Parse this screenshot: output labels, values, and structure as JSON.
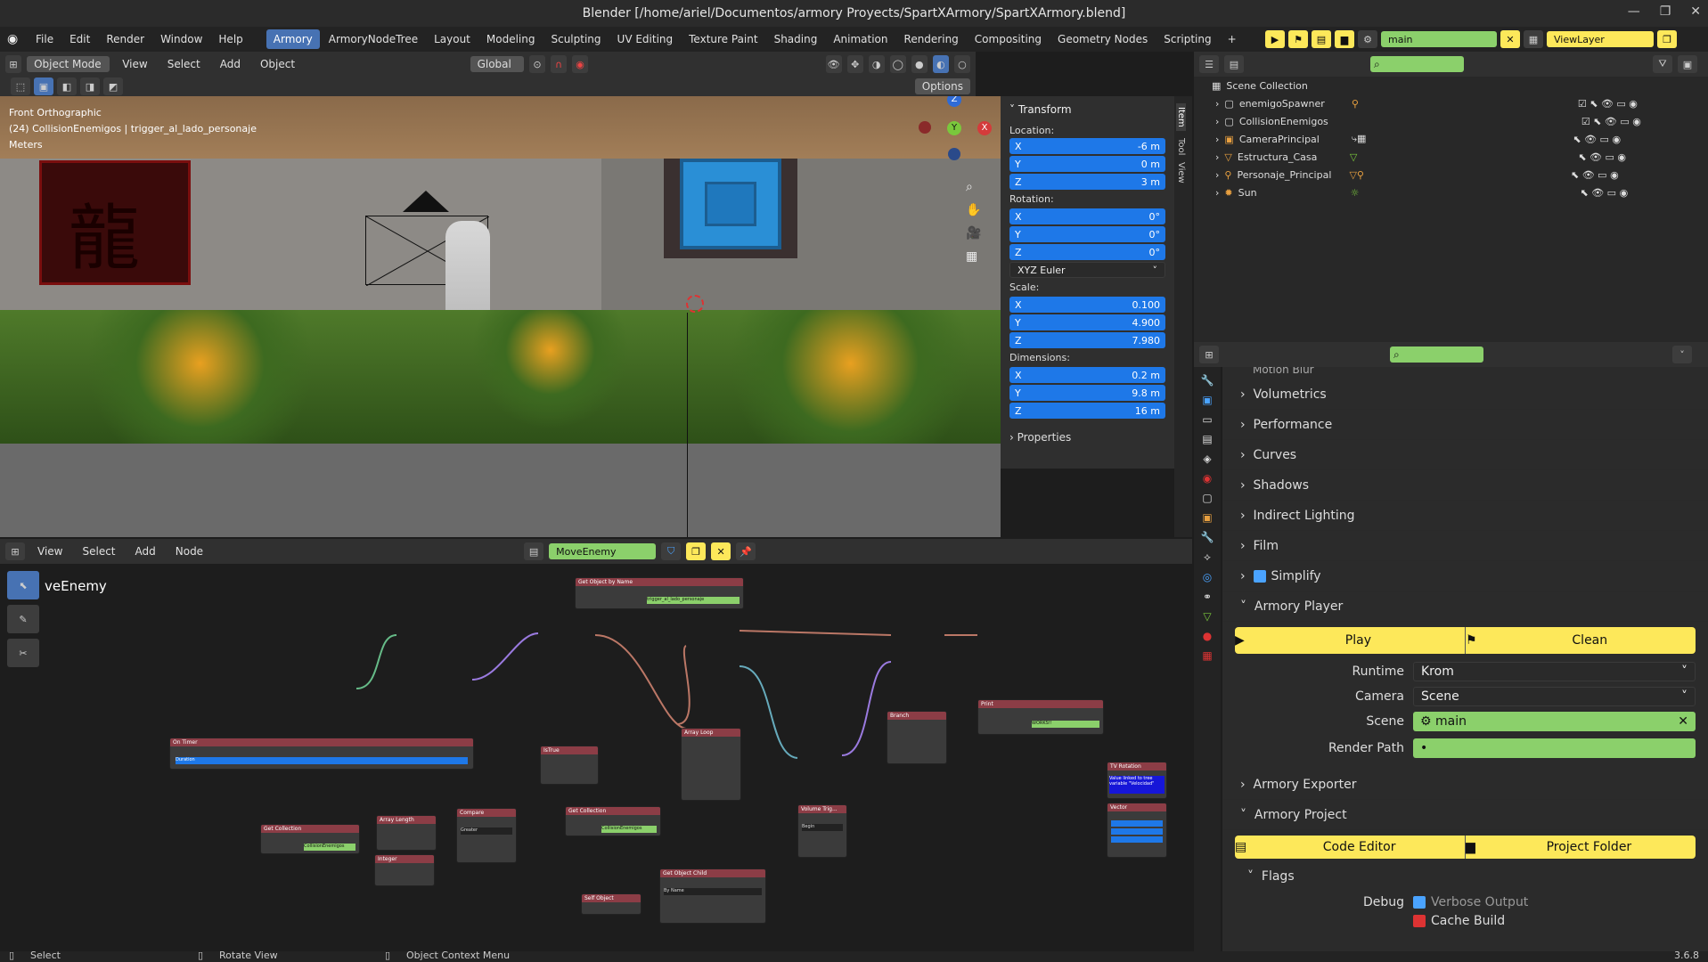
{
  "window": {
    "title": "Blender [/home/ariel/Documentos/armory Proyects/SpartXArmory/SpartXArmory.blend]",
    "min": "—",
    "max": "❐",
    "close": "✕"
  },
  "menus": [
    "File",
    "Edit",
    "Render",
    "Window",
    "Help"
  ],
  "workspaces": [
    "Armory",
    "ArmoryNodeTree",
    "Layout",
    "Modeling",
    "Sculpting",
    "UV Editing",
    "Texture Paint",
    "Shading",
    "Animation",
    "Rendering",
    "Compositing",
    "Geometry Nodes",
    "Scripting",
    "+"
  ],
  "scene_selector": {
    "value": "main"
  },
  "viewlayer": {
    "value": "ViewLayer"
  },
  "viewport": {
    "mode": "Object Mode",
    "menus": [
      "View",
      "Select",
      "Add",
      "Object"
    ],
    "transform_orient": "Global",
    "options": "Options",
    "info": [
      "Front Orthographic",
      "(24) CollisionEnemigos | trigger_al_lado_personaje",
      "Meters"
    ],
    "gizmo": {
      "z": "Z",
      "y": "Y",
      "x": "X"
    },
    "tabs": [
      "Item",
      "Tool",
      "View"
    ]
  },
  "transform": {
    "title": "Transform",
    "location_label": "Location:",
    "location": [
      [
        "X",
        "-6 m"
      ],
      [
        "Y",
        "0 m"
      ],
      [
        "Z",
        "3 m"
      ]
    ],
    "rotation_label": "Rotation:",
    "rotation": [
      [
        "X",
        "0°"
      ],
      [
        "Y",
        "0°"
      ],
      [
        "Z",
        "0°"
      ]
    ],
    "rotation_mode": "XYZ Euler",
    "scale_label": "Scale:",
    "scale": [
      [
        "X",
        "0.100"
      ],
      [
        "Y",
        "4.900"
      ],
      [
        "Z",
        "7.980"
      ]
    ],
    "dimensions_label": "Dimensions:",
    "dimensions": [
      [
        "X",
        "0.2 m"
      ],
      [
        "Y",
        "9.8 m"
      ],
      [
        "Z",
        "16 m"
      ]
    ],
    "properties": "Properties"
  },
  "node_editor": {
    "menus": [
      "View",
      "Select",
      "Add",
      "Node"
    ],
    "tree_name": "MoveEnemy",
    "overlay_title": "veEnemy",
    "nodes": [
      {
        "title": "Get Object by Name",
        "field": "trigger_al_lado_personaje"
      },
      {
        "title": "On Timer",
        "field": "Duration"
      },
      {
        "title": "Get Collection",
        "field": "CollisionEnemigos"
      },
      {
        "title": "Array Length"
      },
      {
        "title": "Integer"
      },
      {
        "title": "Compare",
        "field": "Greater"
      },
      {
        "title": "IsTrue"
      },
      {
        "title": "Get Collection",
        "field": "CollisionEnemigos"
      },
      {
        "title": "Array Loop"
      },
      {
        "title": "Volume Trig...",
        "field": "Begin"
      },
      {
        "title": "Branch"
      },
      {
        "title": "Print",
        "field": "WORKS!!"
      },
      {
        "title": "Get Object Child",
        "field": "By Name"
      },
      {
        "title": "Self Object"
      },
      {
        "title": "TV Rotation",
        "field": "Value linked to tree variable \"Velocidad\""
      },
      {
        "title": "Vector"
      }
    ]
  },
  "outliner": {
    "root": "Scene Collection",
    "items": [
      {
        "name": "enemigoSpawner",
        "icon": "collection-icon",
        "color": "#d0d0d0"
      },
      {
        "name": "CollisionEnemigos",
        "icon": "collection-icon",
        "color": "#d0d0d0"
      },
      {
        "name": "CameraPrincipal",
        "icon": "camera-icon",
        "color": "#e8a040"
      },
      {
        "name": "Estructura_Casa",
        "icon": "mesh-icon",
        "color": "#e8a040"
      },
      {
        "name": "Personaje_Principal",
        "icon": "armature-icon",
        "color": "#e8a040"
      },
      {
        "name": "Sun",
        "icon": "light-icon",
        "color": "#e8a040"
      }
    ]
  },
  "properties": {
    "partial_top": "Motion Blur",
    "sections": [
      "Volumetrics",
      "Performance",
      "Curves",
      "Shadows",
      "Indirect Lighting",
      "Film",
      "Simplify"
    ],
    "armory_player": {
      "title": "Armory Player",
      "play": "Play",
      "clean": "Clean",
      "runtime_label": "Runtime",
      "runtime": "Krom",
      "camera_label": "Camera",
      "camera": "Scene",
      "scene_label": "Scene",
      "scene": "main",
      "render_path_label": "Render Path",
      "render_path": "•"
    },
    "armory_exporter": "Armory Exporter",
    "armory_project": {
      "title": "Armory Project",
      "code_editor": "Code Editor",
      "project_folder": "Project Folder",
      "flags": "Flags",
      "debug_label": "Debug",
      "verbose": "Verbose Output",
      "cache_build": "Cache Build"
    }
  },
  "status": {
    "select": "Select",
    "rotate": "Rotate View",
    "context": "Object Context Menu",
    "version": "3.6.8"
  }
}
